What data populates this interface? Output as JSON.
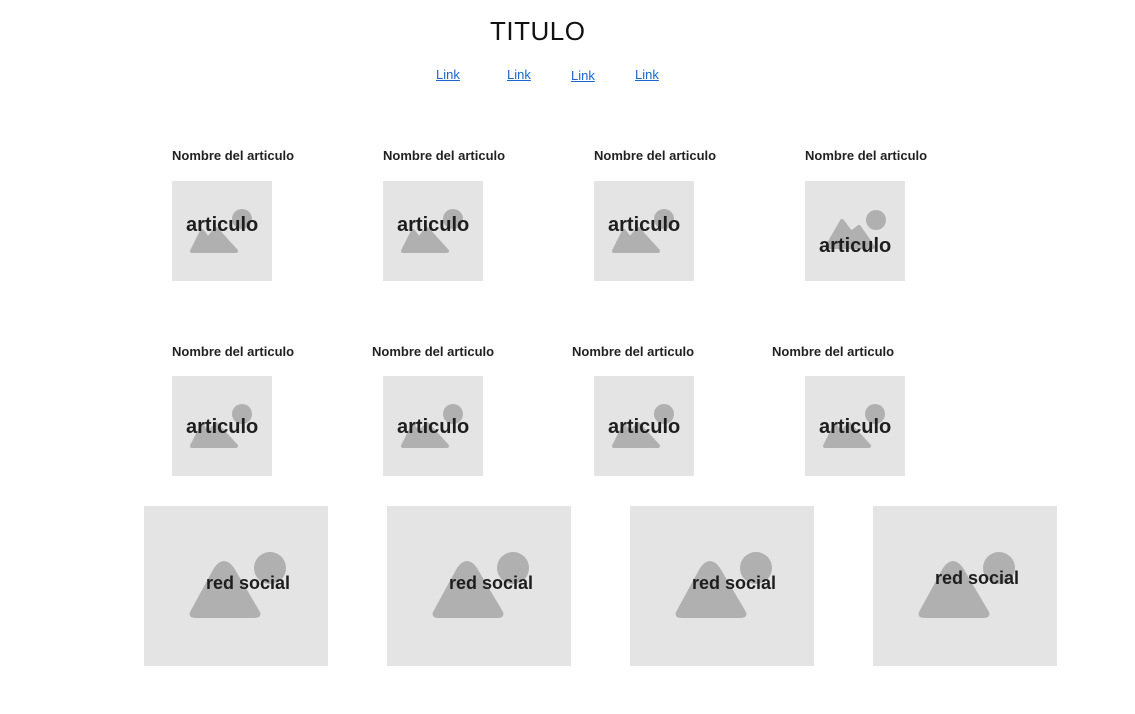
{
  "header": {
    "title": "TITULO",
    "links": [
      "Link",
      "Link",
      "Link",
      "Link"
    ]
  },
  "articles": {
    "row1": [
      {
        "name": "Nombre del articulo",
        "label": "articulo",
        "icon": "image-placeholder-icon"
      },
      {
        "name": "Nombre del articulo",
        "label": "articulo",
        "icon": "image-placeholder-icon"
      },
      {
        "name": "Nombre del articulo",
        "label": "articulo",
        "icon": "image-placeholder-icon"
      },
      {
        "name": "Nombre del articulo",
        "label": "articulo",
        "icon": "image-placeholder-icon"
      }
    ],
    "row2": [
      {
        "name": "Nombre del articulo",
        "label": "articulo",
        "icon": "image-placeholder-icon"
      },
      {
        "name": "Nombre del articulo",
        "label": "articulo",
        "icon": "image-placeholder-icon"
      },
      {
        "name": "Nombre del articulo",
        "label": "articulo",
        "icon": "image-placeholder-icon"
      },
      {
        "name": "Nombre del articulo",
        "label": "articulo",
        "icon": "image-placeholder-icon"
      }
    ]
  },
  "social": [
    {
      "label": "red social",
      "icon": "image-placeholder-icon"
    },
    {
      "label": "red social",
      "icon": "image-placeholder-icon"
    },
    {
      "label": "red social",
      "icon": "image-placeholder-icon"
    },
    {
      "label": "red social",
      "icon": "image-placeholder-icon"
    }
  ],
  "colors": {
    "placeholder_bg": "#e4e4e4",
    "placeholder_icon": "#b0b0b0",
    "link": "#1a66cc"
  }
}
